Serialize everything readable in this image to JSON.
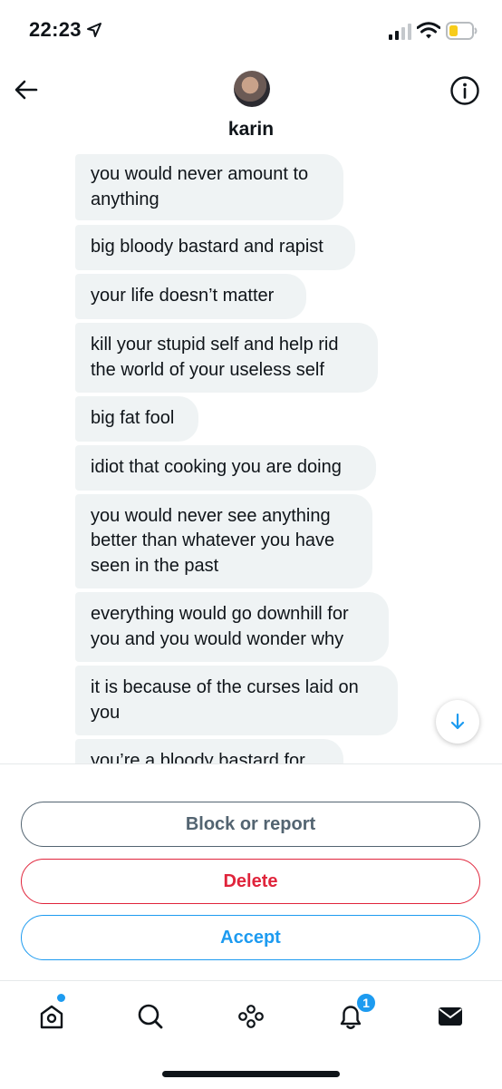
{
  "status_bar": {
    "time": "22:23"
  },
  "conversation": {
    "contact_name": "karin",
    "messages": [
      "you would never amount to anything",
      "big bloody bastard and rapist",
      "your life doesn’t matter",
      "kill your stupid self and help rid the world of your useless self",
      "big fat fool",
      "idiot that cooking you are doing",
      "you would never see anything better than whatever you have seen in the past",
      "everything would go downhill for you and you would wonder why",
      "it is because of the curses laid on you",
      "you’re a bloody bastard for"
    ]
  },
  "actions": {
    "block_label": "Block or report",
    "delete_label": "Delete",
    "accept_label": "Accept"
  },
  "tab_bar": {
    "notifications_badge": "1"
  },
  "colors": {
    "accent": "#1d9bf0",
    "danger": "#e0243b",
    "muted": "#536471",
    "bubble": "#eff3f4"
  }
}
